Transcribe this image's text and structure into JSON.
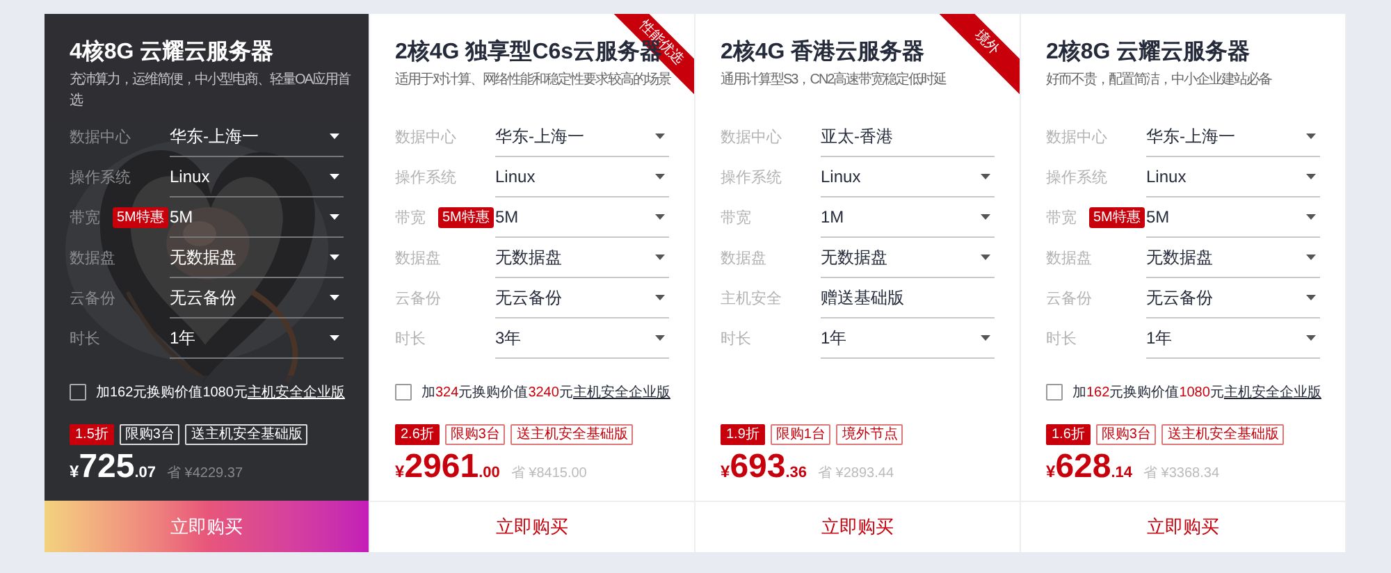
{
  "cards": [
    {
      "selected": true,
      "title": "4核8G 云耀云服务器",
      "subtitle": "充沛算力，运维简便，中小型电商、轻量OA应用首选",
      "fields": [
        {
          "label": "数据中心",
          "value": "华东-上海一",
          "dropdown": true
        },
        {
          "label": "操作系统",
          "value": "Linux",
          "dropdown": true
        },
        {
          "label": "带宽",
          "badge": "5M特惠",
          "value": "5M",
          "dropdown": true
        },
        {
          "label": "数据盘",
          "value": "无数据盘",
          "dropdown": true
        },
        {
          "label": "云备份",
          "value": "无云备份",
          "dropdown": true
        },
        {
          "label": "时长",
          "value": "1年",
          "dropdown": true
        }
      ],
      "offer": {
        "checked": false,
        "prefix": "加",
        "amount": "162",
        "middle": "元换购价值",
        "worth": "1080",
        "suffix": "元",
        "link": "主机安全企业版"
      },
      "tags": [
        {
          "text": "1.5折",
          "kind": "discount"
        },
        {
          "text": "限购3台",
          "kind": "outline"
        },
        {
          "text": "送主机安全基础版",
          "kind": "outline"
        }
      ],
      "price": {
        "currency": "¥",
        "integer": "725",
        "decimal": ".07",
        "saving": "省 ¥4229.37"
      },
      "buy": "立即购买"
    },
    {
      "selected": false,
      "ribbon": "性能优选",
      "title": "2核4G 独享型C6s云服务器",
      "subtitle": "适用于对计算、网络性能和稳定性要求较高的场景",
      "fields": [
        {
          "label": "数据中心",
          "value": "华东-上海一",
          "dropdown": true
        },
        {
          "label": "操作系统",
          "value": "Linux",
          "dropdown": true
        },
        {
          "label": "带宽",
          "badge": "5M特惠",
          "value": "5M",
          "dropdown": true
        },
        {
          "label": "数据盘",
          "value": "无数据盘",
          "dropdown": true
        },
        {
          "label": "云备份",
          "value": "无云备份",
          "dropdown": true
        },
        {
          "label": "时长",
          "value": "3年",
          "dropdown": true
        }
      ],
      "offer": {
        "checked": false,
        "prefix": "加",
        "amount": "324",
        "middle": "元换购价值",
        "worth": "3240",
        "suffix": "元",
        "link": "主机安全企业版"
      },
      "tags": [
        {
          "text": "2.6折",
          "kind": "discount"
        },
        {
          "text": "限购3台",
          "kind": "outline"
        },
        {
          "text": "送主机安全基础版",
          "kind": "outline"
        }
      ],
      "price": {
        "currency": "¥",
        "integer": "2961",
        "decimal": ".00",
        "saving": "省 ¥8415.00"
      },
      "buy": "立即购买"
    },
    {
      "selected": false,
      "ribbon": "境外",
      "title": "2核4G 香港云服务器",
      "subtitle": "通用计算型S3，CN2高速带宽稳定低时延",
      "fields": [
        {
          "label": "数据中心",
          "value": "亚太-香港",
          "dropdown": false
        },
        {
          "label": "操作系统",
          "value": "Linux",
          "dropdown": true
        },
        {
          "label": "带宽",
          "value": "1M",
          "dropdown": true
        },
        {
          "label": "数据盘",
          "value": "无数据盘",
          "dropdown": true
        },
        {
          "label": "主机安全",
          "value": "赠送基础版",
          "dropdown": false
        },
        {
          "label": "时长",
          "value": "1年",
          "dropdown": true
        }
      ],
      "tags": [
        {
          "text": "1.9折",
          "kind": "discount"
        },
        {
          "text": "限购1台",
          "kind": "outline"
        },
        {
          "text": "境外节点",
          "kind": "outline"
        }
      ],
      "price": {
        "currency": "¥",
        "integer": "693",
        "decimal": ".36",
        "saving": "省 ¥2893.44"
      },
      "buy": "立即购买"
    },
    {
      "selected": false,
      "title": "2核8G 云耀云服务器",
      "subtitle": "好而不贵，配置简洁，中小企业建站必备",
      "fields": [
        {
          "label": "数据中心",
          "value": "华东-上海一",
          "dropdown": true
        },
        {
          "label": "操作系统",
          "value": "Linux",
          "dropdown": true
        },
        {
          "label": "带宽",
          "badge": "5M特惠",
          "value": "5M",
          "dropdown": true
        },
        {
          "label": "数据盘",
          "value": "无数据盘",
          "dropdown": true
        },
        {
          "label": "云备份",
          "value": "无云备份",
          "dropdown": true
        },
        {
          "label": "时长",
          "value": "1年",
          "dropdown": true
        }
      ],
      "offer": {
        "checked": false,
        "prefix": "加",
        "amount": "162",
        "middle": "元换购价值",
        "worth": "1080",
        "suffix": "元",
        "link": "主机安全企业版"
      },
      "tags": [
        {
          "text": "1.6折",
          "kind": "discount"
        },
        {
          "text": "限购3台",
          "kind": "outline"
        },
        {
          "text": "送主机安全基础版",
          "kind": "outline"
        }
      ],
      "price": {
        "currency": "¥",
        "integer": "628",
        "decimal": ".14",
        "saving": "省 ¥3368.34"
      },
      "buy": "立即购买"
    }
  ]
}
